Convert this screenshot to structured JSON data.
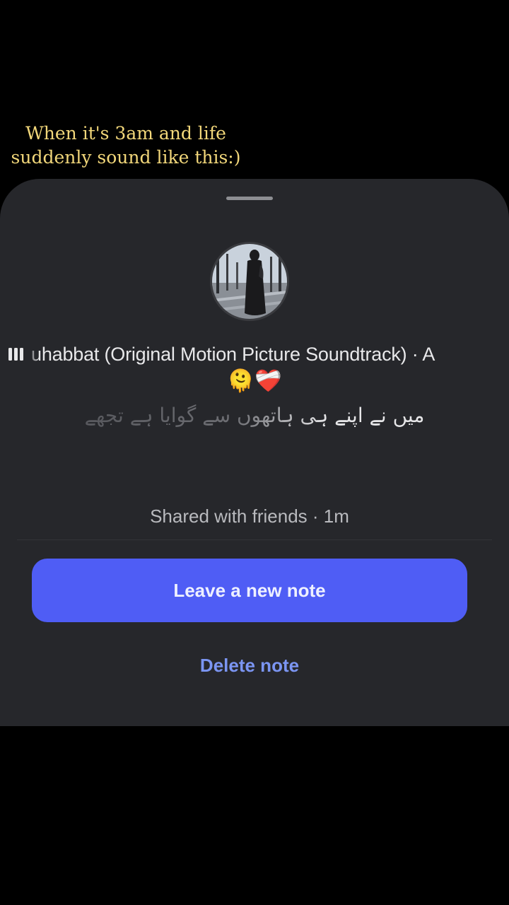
{
  "overlay": {
    "caption_line1": "When it's 3am and life",
    "caption_line2": "suddenly sound like this:)"
  },
  "note": {
    "song_title": "uhabbat (Original Motion Picture Soundtrack) · A",
    "emojis": "🫠❤️‍🩹",
    "lyric": "میں نے اپنے ہی ہاتھوں سے گوایا ہے تجھے",
    "shared_status": "Shared with friends · 1m"
  },
  "actions": {
    "primary_label": "Leave a new note",
    "secondary_label": "Delete note"
  },
  "colors": {
    "background": "#000000",
    "sheet": "#26272b",
    "caption": "#f2d77a",
    "primary_button": "#4f5df5",
    "link": "#7b95f2"
  },
  "icons": {
    "music_bars": "music-bars-icon",
    "avatar": "profile-avatar"
  }
}
